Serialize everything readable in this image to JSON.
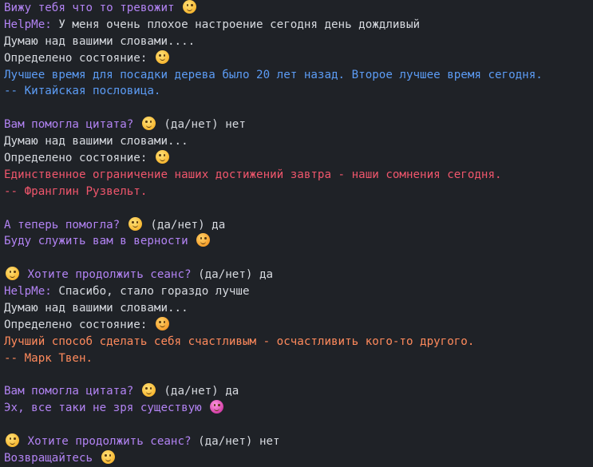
{
  "colors": {
    "background": "#1f2227",
    "text": "#d7dae0",
    "prompt": "#b283f3",
    "quote_blue": "#5c9cf5",
    "quote_red": "#f0566c",
    "quote_orange": "#ff8a5c"
  },
  "lines": [
    {
      "segments": [
        {
          "text": "Вижу тебя что то тревожит",
          "color": "purple"
        }
      ],
      "emoji": "worried-face-icon"
    },
    {
      "segments": [
        {
          "text": "HelpMe:",
          "color": "purple"
        },
        {
          "text": " У меня очень плохое настроение сегодня день дождливый",
          "color": "white"
        }
      ]
    },
    {
      "segments": [
        {
          "text": "Думаю над вашими словами....",
          "color": "white"
        }
      ]
    },
    {
      "segments": [
        {
          "text": "Определено состояние:",
          "color": "white"
        }
      ],
      "emoji": "sad-face-icon"
    },
    {
      "segments": [
        {
          "text": "Лучшее время для посадки дерева было 20 лет назад. Второе лучшее время сегодня.",
          "color": "blue"
        }
      ]
    },
    {
      "segments": [
        {
          "text": "-- Китайская пословица.",
          "color": "blue"
        }
      ]
    },
    {
      "blank": true
    },
    {
      "segments": [
        {
          "text": "Вам помогла цитата?",
          "color": "purple"
        }
      ],
      "emoji": "smile-face-icon",
      "after": [
        {
          "text": "(да/нет) нет",
          "color": "white"
        }
      ]
    },
    {
      "segments": [
        {
          "text": "Думаю над вашими словами...",
          "color": "white"
        }
      ]
    },
    {
      "segments": [
        {
          "text": "Определено состояние:",
          "color": "white"
        }
      ],
      "emoji": "neutral-face-icon"
    },
    {
      "segments": [
        {
          "text": "Единственное ограничение наших достижений завтра - наши сомнения сегодня.",
          "color": "red"
        }
      ]
    },
    {
      "segments": [
        {
          "text": "-- Франглин Рузвельт.",
          "color": "red"
        }
      ]
    },
    {
      "blank": true
    },
    {
      "segments": [
        {
          "text": "А теперь помогла?",
          "color": "purple"
        }
      ],
      "emoji": "blush-face-icon",
      "after": [
        {
          "text": "(да/нет) да",
          "color": "white"
        }
      ]
    },
    {
      "segments": [
        {
          "text": "Буду служить вам в верности",
          "color": "purple"
        }
      ],
      "emoji": "salute-face-icon"
    },
    {
      "blank": true
    },
    {
      "segments": [],
      "emoji": "smile-face-icon",
      "after": [
        {
          "text": "Хотите продолжить сеанс?",
          "color": "purple"
        },
        {
          "text": " (да/нет) да",
          "color": "white"
        }
      ]
    },
    {
      "segments": [
        {
          "text": "HelpMe:",
          "color": "purple"
        },
        {
          "text": " Спасибо, стало гораздо лучше",
          "color": "white"
        }
      ]
    },
    {
      "segments": [
        {
          "text": "Думаю над вашими словами...",
          "color": "white"
        }
      ]
    },
    {
      "segments": [
        {
          "text": "Определено состояние:",
          "color": "white"
        }
      ],
      "emoji": "hug-face-icon"
    },
    {
      "segments": [
        {
          "text": "Лучший способ сделать себя счастливым - осчастливить кого-то другого.",
          "color": "orange"
        }
      ]
    },
    {
      "segments": [
        {
          "text": "-- Марк Твен.",
          "color": "orange"
        }
      ]
    },
    {
      "blank": true
    },
    {
      "segments": [
        {
          "text": "Вам помогла цитата?",
          "color": "purple"
        }
      ],
      "emoji": "smile-face-icon",
      "after": [
        {
          "text": "(да/нет) да",
          "color": "white"
        }
      ]
    },
    {
      "segments": [
        {
          "text": "Эх, все таки не зря существую",
          "color": "purple"
        }
      ],
      "emoji": "grin-face-icon"
    },
    {
      "blank": true
    },
    {
      "segments": [],
      "emoji": "smile-face-icon",
      "after": [
        {
          "text": "Хотите продолжить сеанс?",
          "color": "purple"
        },
        {
          "text": " (да/нет) нет",
          "color": "white"
        }
      ]
    },
    {
      "segments": [
        {
          "text": "Возвращайтесь",
          "color": "purple"
        }
      ],
      "emoji": "smile-face-icon"
    }
  ]
}
